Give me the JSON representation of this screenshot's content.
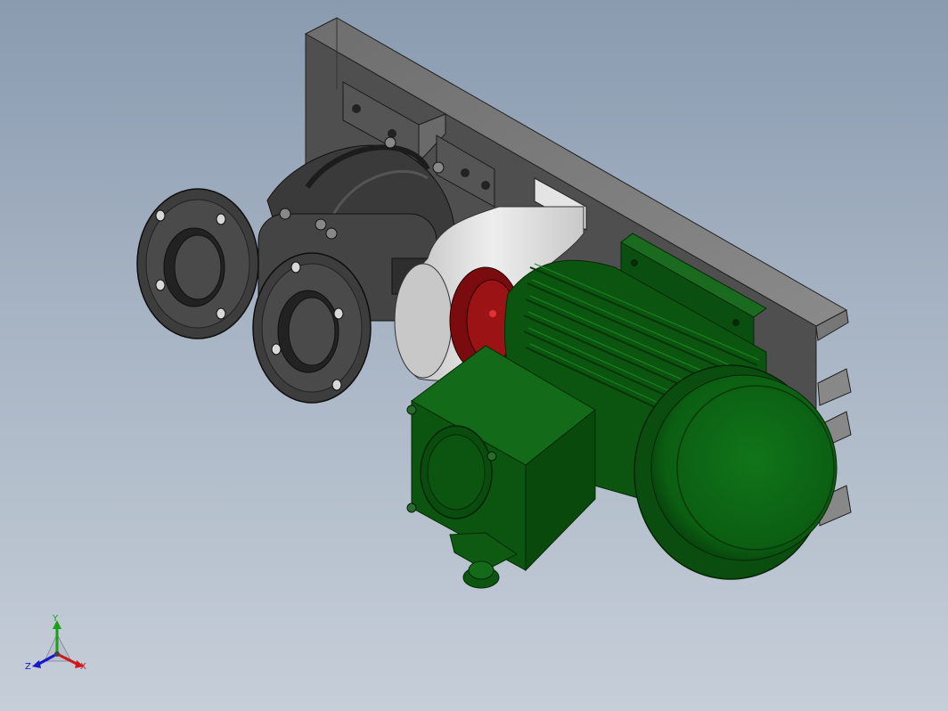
{
  "viewport": {
    "background_top": "#8a9bb0",
    "background_bottom": "#c6ced8"
  },
  "model": {
    "parts": [
      {
        "name": "base-plate",
        "color": "#5a5a5a"
      },
      {
        "name": "pump-housing",
        "color": "#3c3c3c"
      },
      {
        "name": "coupling-guard",
        "color": "#d6d6d6"
      },
      {
        "name": "coupling-flange",
        "color": "#8a0f12"
      },
      {
        "name": "motor",
        "color": "#0e5a12"
      }
    ]
  },
  "triad": {
    "x_label": "X",
    "y_label": "Y",
    "z_label": "Z",
    "x_color": "#d01818",
    "y_color": "#18a018",
    "z_color": "#1818c8"
  }
}
